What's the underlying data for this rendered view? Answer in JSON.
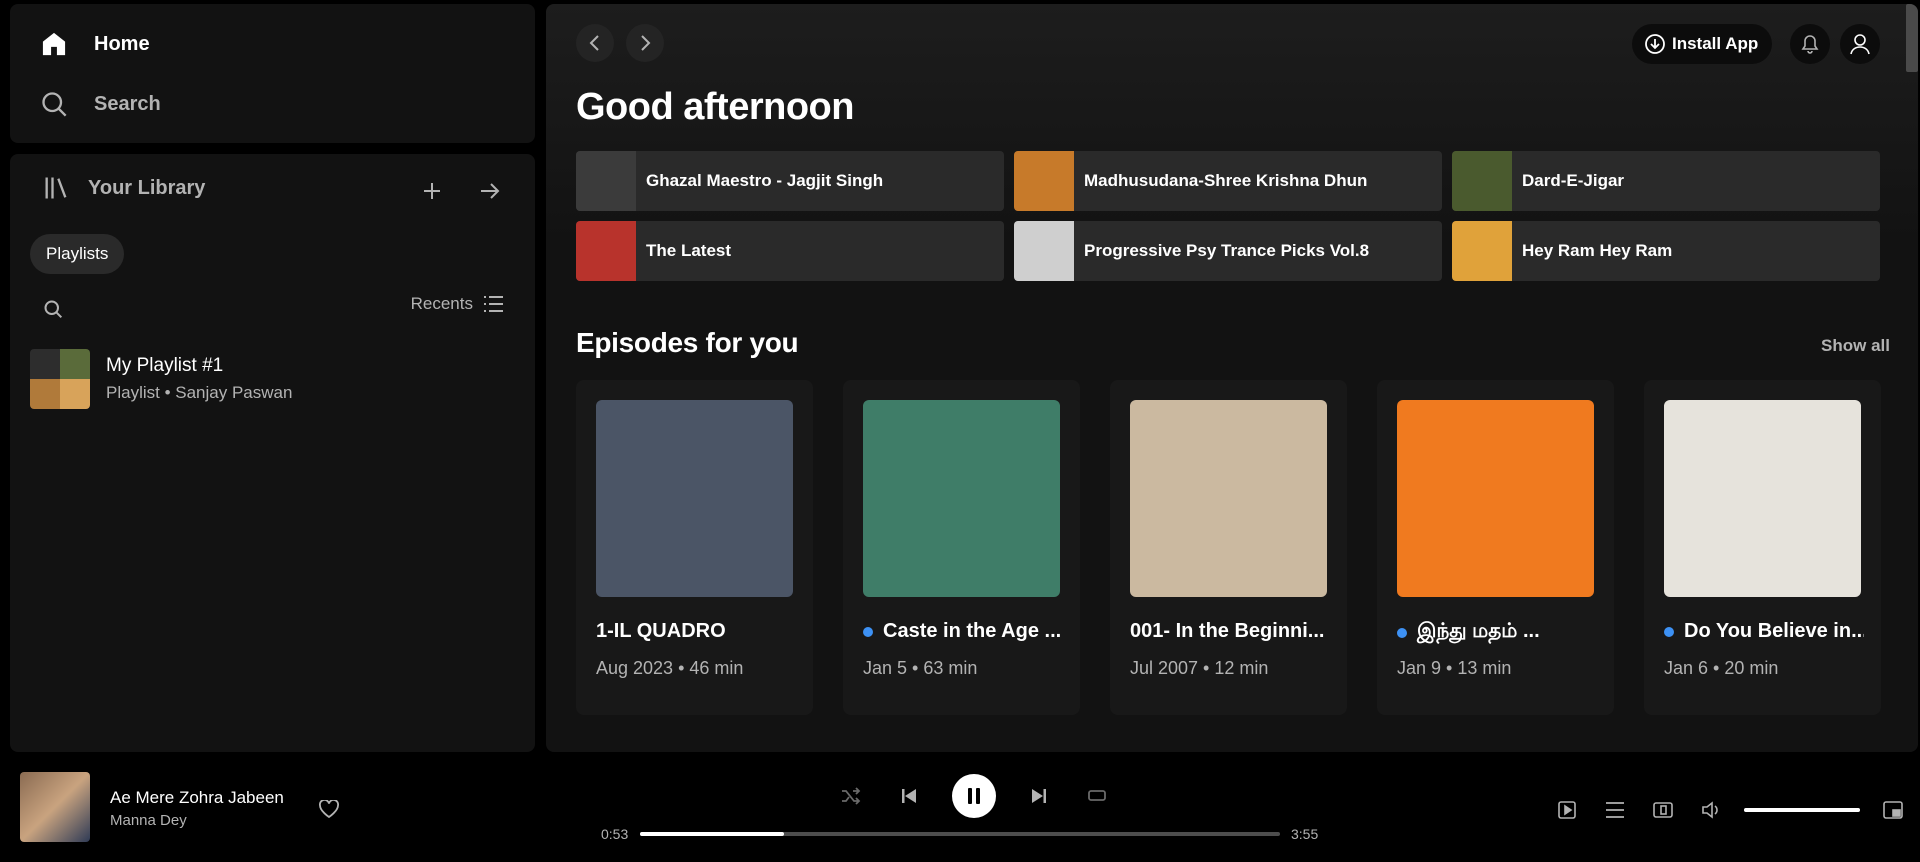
{
  "nav": {
    "home_label": "Home",
    "search_label": "Search"
  },
  "library": {
    "title": "Your Library",
    "filter_chip": "Playlists",
    "sort_label": "Recents",
    "items": [
      {
        "title": "My Playlist #1",
        "subtitle": "Playlist • Sanjay Paswan"
      }
    ]
  },
  "topbar": {
    "install_label": "Install App"
  },
  "greeting": "Good afternoon",
  "shortcuts": [
    {
      "label": "Ghazal Maestro - Jagjit Singh",
      "color": "#3b3b3b"
    },
    {
      "label": "Madhusudana-Shree Krishna Dhun",
      "color": "#c77a2a"
    },
    {
      "label": "Dard-E-Jigar",
      "color": "#4a5a2e"
    },
    {
      "label": "The Latest",
      "color": "#b8332c"
    },
    {
      "label": "Progressive Psy Trance Picks Vol.8",
      "color": "#cfcfcf"
    },
    {
      "label": "Hey Ram Hey Ram",
      "color": "#e0a23a"
    }
  ],
  "episodes": {
    "title": "Episodes for you",
    "show_all": "Show all",
    "items": [
      {
        "title": "1-IL QUADRO",
        "meta": "Aug 2023 • 46 min",
        "unplayed": false,
        "color": "#4b5566"
      },
      {
        "title": "Caste in the Age ...",
        "meta": "Jan 5 • 63 min",
        "unplayed": true,
        "color": "#3f7d68"
      },
      {
        "title": "001- In the Beginni...",
        "meta": "Jul 2007 • 12 min",
        "unplayed": false,
        "color": "#cbb9a0"
      },
      {
        "title": "இந்து மதம் ...",
        "meta": "Jan 9 • 13 min",
        "unplayed": true,
        "color": "#f07a1f"
      },
      {
        "title": "Do You Believe in...",
        "meta": "Jan 6 • 20 min",
        "unplayed": true,
        "color": "#e6e3dc"
      }
    ]
  },
  "player": {
    "track": "Ae Mere Zohra Jabeen",
    "artist": "Manna Dey",
    "elapsed": "0:53",
    "duration": "3:55",
    "progress_fraction": 0.225,
    "volume_fraction": 1.0
  }
}
